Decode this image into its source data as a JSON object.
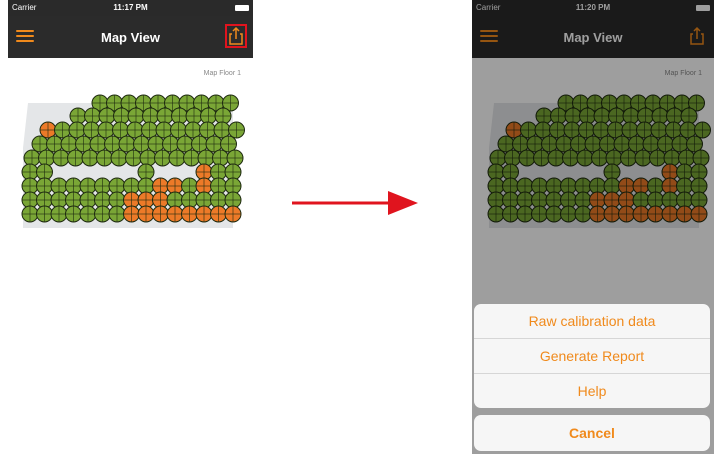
{
  "left_screen": {
    "status": {
      "carrier": "Carrier",
      "time": "11:17 PM"
    },
    "nav": {
      "title": "Map View"
    },
    "map": {
      "label": "Map Floor 1"
    }
  },
  "right_screen": {
    "status": {
      "carrier": "Carrier",
      "time": "11:20 PM"
    },
    "nav": {
      "title": "Map View"
    },
    "map": {
      "label": "Map Floor 1"
    },
    "action_sheet": {
      "items": [
        "Raw calibration data",
        "Generate Report",
        "Help"
      ],
      "cancel": "Cancel"
    }
  },
  "colors": {
    "accent": "#f08a1c",
    "nav_bg": "#2b2b2b",
    "node_green": "#7aa636",
    "node_orange": "#ec7a28",
    "highlight": "#e0141e",
    "arrow": "#e0141e"
  },
  "icons": [
    "menu-icon",
    "share-icon",
    "wifi-icon",
    "battery-icon",
    "arrow-right-icon"
  ]
}
